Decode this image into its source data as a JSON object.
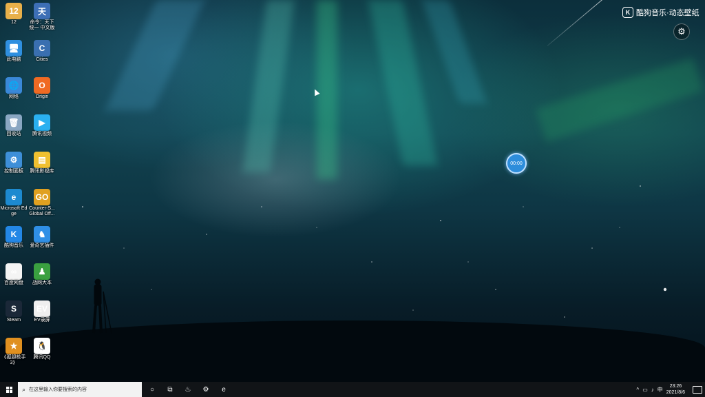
{
  "wallpaper": {
    "brand_label": "酷狗音乐·动态壁纸",
    "brand_icon": "kugou-k-icon",
    "settings_icon": "gear-icon",
    "timer_value": "00:00"
  },
  "desktop_icons": [
    {
      "label": "12",
      "icon": "folder-user-icon",
      "color": "#e8b04a",
      "glyph": "12"
    },
    {
      "label": "命令：天下统一 中文版",
      "icon": "game-shortcut-icon",
      "color": "#3d6fb6",
      "glyph": "天"
    },
    {
      "label": "此电脑",
      "icon": "computer-icon",
      "color": "#2f8fe0",
      "glyph": "🖥"
    },
    {
      "label": "Cities",
      "icon": "cities-icon",
      "color": "#3a6fb0",
      "glyph": "C"
    },
    {
      "label": "网络",
      "icon": "network-icon",
      "color": "#3a88d8",
      "glyph": "🌐"
    },
    {
      "label": "Origin",
      "icon": "origin-icon",
      "color": "#f06a23",
      "glyph": "O"
    },
    {
      "label": "回收站",
      "icon": "recycle-bin-icon",
      "color": "#8aa7c2",
      "glyph": "🗑"
    },
    {
      "label": "腾讯视频",
      "icon": "tencent-video-icon",
      "color": "#2ab0f0",
      "glyph": "▶"
    },
    {
      "label": "控制面板",
      "icon": "control-panel-icon",
      "color": "#3e8fd8",
      "glyph": "⚙"
    },
    {
      "label": "腾讯影视库",
      "icon": "folder-icon",
      "color": "#f0c030",
      "glyph": "▤"
    },
    {
      "label": "Microsoft Edge",
      "icon": "edge-icon",
      "color": "#1d8ad0",
      "glyph": "e"
    },
    {
      "label": "Counter-S... Global Off...",
      "icon": "csgo-icon",
      "color": "#e0a020",
      "glyph": "GO"
    },
    {
      "label": "酷狗音乐",
      "icon": "kugou-icon",
      "color": "#2387e6",
      "glyph": "K"
    },
    {
      "label": "爱奇艺插件",
      "icon": "bunny-icon",
      "color": "#2f8fe6",
      "glyph": "♞"
    },
    {
      "label": "百度网盘",
      "icon": "baidu-netdisk-icon",
      "color": "#f4f4f4",
      "glyph": "∞"
    },
    {
      "label": "战网大本",
      "icon": "game-center-icon",
      "color": "#3aa040",
      "glyph": "♟"
    },
    {
      "label": "Steam",
      "icon": "steam-icon",
      "color": "#1b2838",
      "glyph": "S"
    },
    {
      "label": "EV录屏",
      "icon": "ev-recorder-icon",
      "color": "#efefef",
      "glyph": "EV"
    },
    {
      "label": "《孤胆枪手 3》",
      "icon": "game-icon",
      "color": "#e09020",
      "glyph": "★"
    },
    {
      "label": "腾讯QQ",
      "icon": "qq-icon",
      "color": "#ffffff",
      "glyph": "🐧"
    }
  ],
  "taskbar": {
    "search_placeholder": "在这里输入你要搜索的内容",
    "search_icon": "search-icon",
    "apps": [
      {
        "name": "cortana-icon",
        "glyph": "○"
      },
      {
        "name": "task-view-icon",
        "glyph": "⧉"
      },
      {
        "name": "steam-icon",
        "glyph": "♨"
      },
      {
        "name": "settings-icon",
        "glyph": "⚙"
      },
      {
        "name": "edge-icon",
        "glyph": "e"
      }
    ],
    "tray": {
      "chevron": "^",
      "ime": "中",
      "time": "23:26",
      "date": "2021/8/6"
    }
  }
}
